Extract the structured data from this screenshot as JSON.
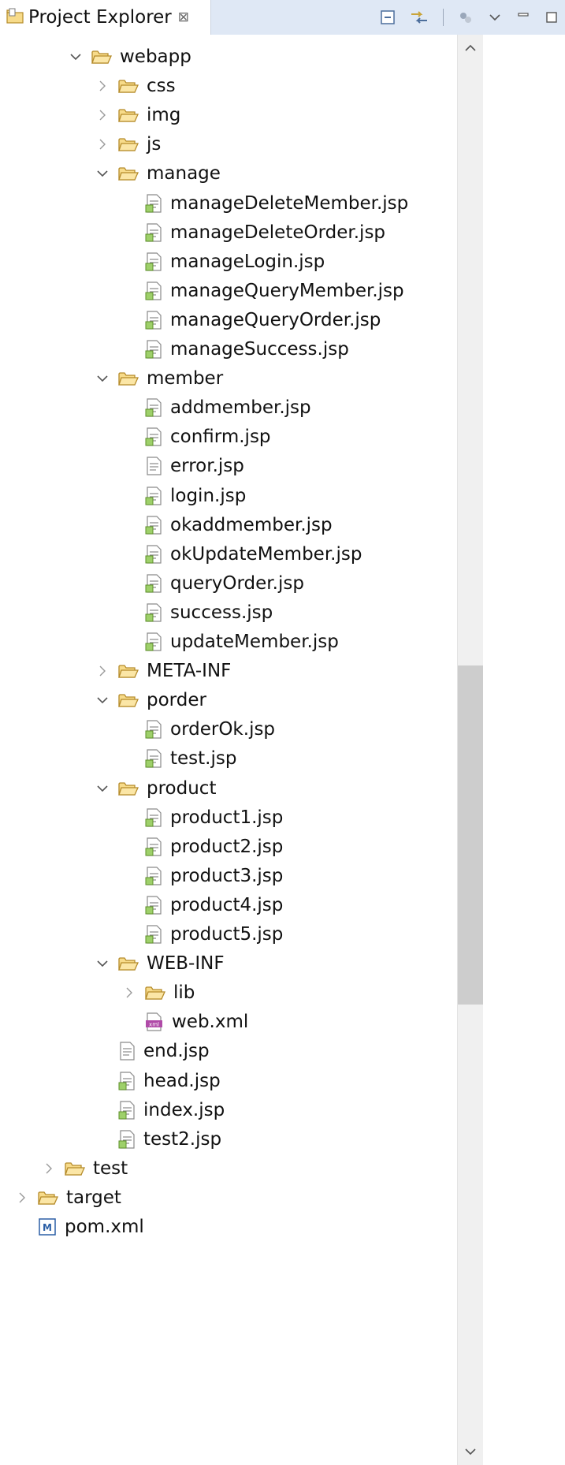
{
  "view": {
    "title": "Project Explorer",
    "close_glyph": "⊠"
  },
  "toolbar": {
    "buttons": [
      "collapse-all",
      "link-with-editor",
      "filters",
      "view-menu",
      "minimize",
      "maximize"
    ]
  },
  "tree": {
    "items": [
      {
        "label": "webapp",
        "type": "folder",
        "state": "expanded"
      },
      {
        "label": "css",
        "type": "folder",
        "state": "collapsed"
      },
      {
        "label": "img",
        "type": "folder",
        "state": "collapsed"
      },
      {
        "label": "js",
        "type": "folder",
        "state": "collapsed"
      },
      {
        "label": "manage",
        "type": "folder",
        "state": "expanded"
      },
      {
        "label": "manageDeleteMember.jsp",
        "type": "jsp"
      },
      {
        "label": "manageDeleteOrder.jsp",
        "type": "jsp"
      },
      {
        "label": "manageLogin.jsp",
        "type": "jsp"
      },
      {
        "label": "manageQueryMember.jsp",
        "type": "jsp"
      },
      {
        "label": "manageQueryOrder.jsp",
        "type": "jsp"
      },
      {
        "label": "manageSuccess.jsp",
        "type": "jsp"
      },
      {
        "label": "member",
        "type": "folder",
        "state": "expanded"
      },
      {
        "label": "addmember.jsp",
        "type": "jsp"
      },
      {
        "label": "confirm.jsp",
        "type": "jsp"
      },
      {
        "label": "error.jsp",
        "type": "jsp-plain"
      },
      {
        "label": "login.jsp",
        "type": "jsp"
      },
      {
        "label": "okaddmember.jsp",
        "type": "jsp"
      },
      {
        "label": "okUpdateMember.jsp",
        "type": "jsp"
      },
      {
        "label": "queryOrder.jsp",
        "type": "jsp"
      },
      {
        "label": "success.jsp",
        "type": "jsp"
      },
      {
        "label": "updateMember.jsp",
        "type": "jsp"
      },
      {
        "label": "META-INF",
        "type": "folder",
        "state": "collapsed"
      },
      {
        "label": "porder",
        "type": "folder",
        "state": "expanded"
      },
      {
        "label": "orderOk.jsp",
        "type": "jsp"
      },
      {
        "label": "test.jsp",
        "type": "jsp"
      },
      {
        "label": "product",
        "type": "folder",
        "state": "expanded"
      },
      {
        "label": "product1.jsp",
        "type": "jsp"
      },
      {
        "label": "product2.jsp",
        "type": "jsp"
      },
      {
        "label": "product3.jsp",
        "type": "jsp"
      },
      {
        "label": "product4.jsp",
        "type": "jsp"
      },
      {
        "label": "product5.jsp",
        "type": "jsp"
      },
      {
        "label": "WEB-INF",
        "type": "folder",
        "state": "expanded"
      },
      {
        "label": "lib",
        "type": "folder",
        "state": "collapsed"
      },
      {
        "label": "web.xml",
        "type": "xml"
      },
      {
        "label": "end.jsp",
        "type": "jsp-plain"
      },
      {
        "label": "head.jsp",
        "type": "jsp"
      },
      {
        "label": "index.jsp",
        "type": "jsp"
      },
      {
        "label": "test2.jsp",
        "type": "jsp"
      },
      {
        "label": "test",
        "type": "folder",
        "state": "collapsed"
      },
      {
        "label": "target",
        "type": "folder",
        "state": "collapsed"
      },
      {
        "label": "pom.xml",
        "type": "maven"
      }
    ]
  },
  "colors": {
    "folder_fill": "#f7db8a",
    "folder_stroke": "#b58b2a",
    "toolbar_bg": "#dfe8f5",
    "xml_accent": "#b04aa8",
    "maven_accent": "#2b5fa6"
  }
}
